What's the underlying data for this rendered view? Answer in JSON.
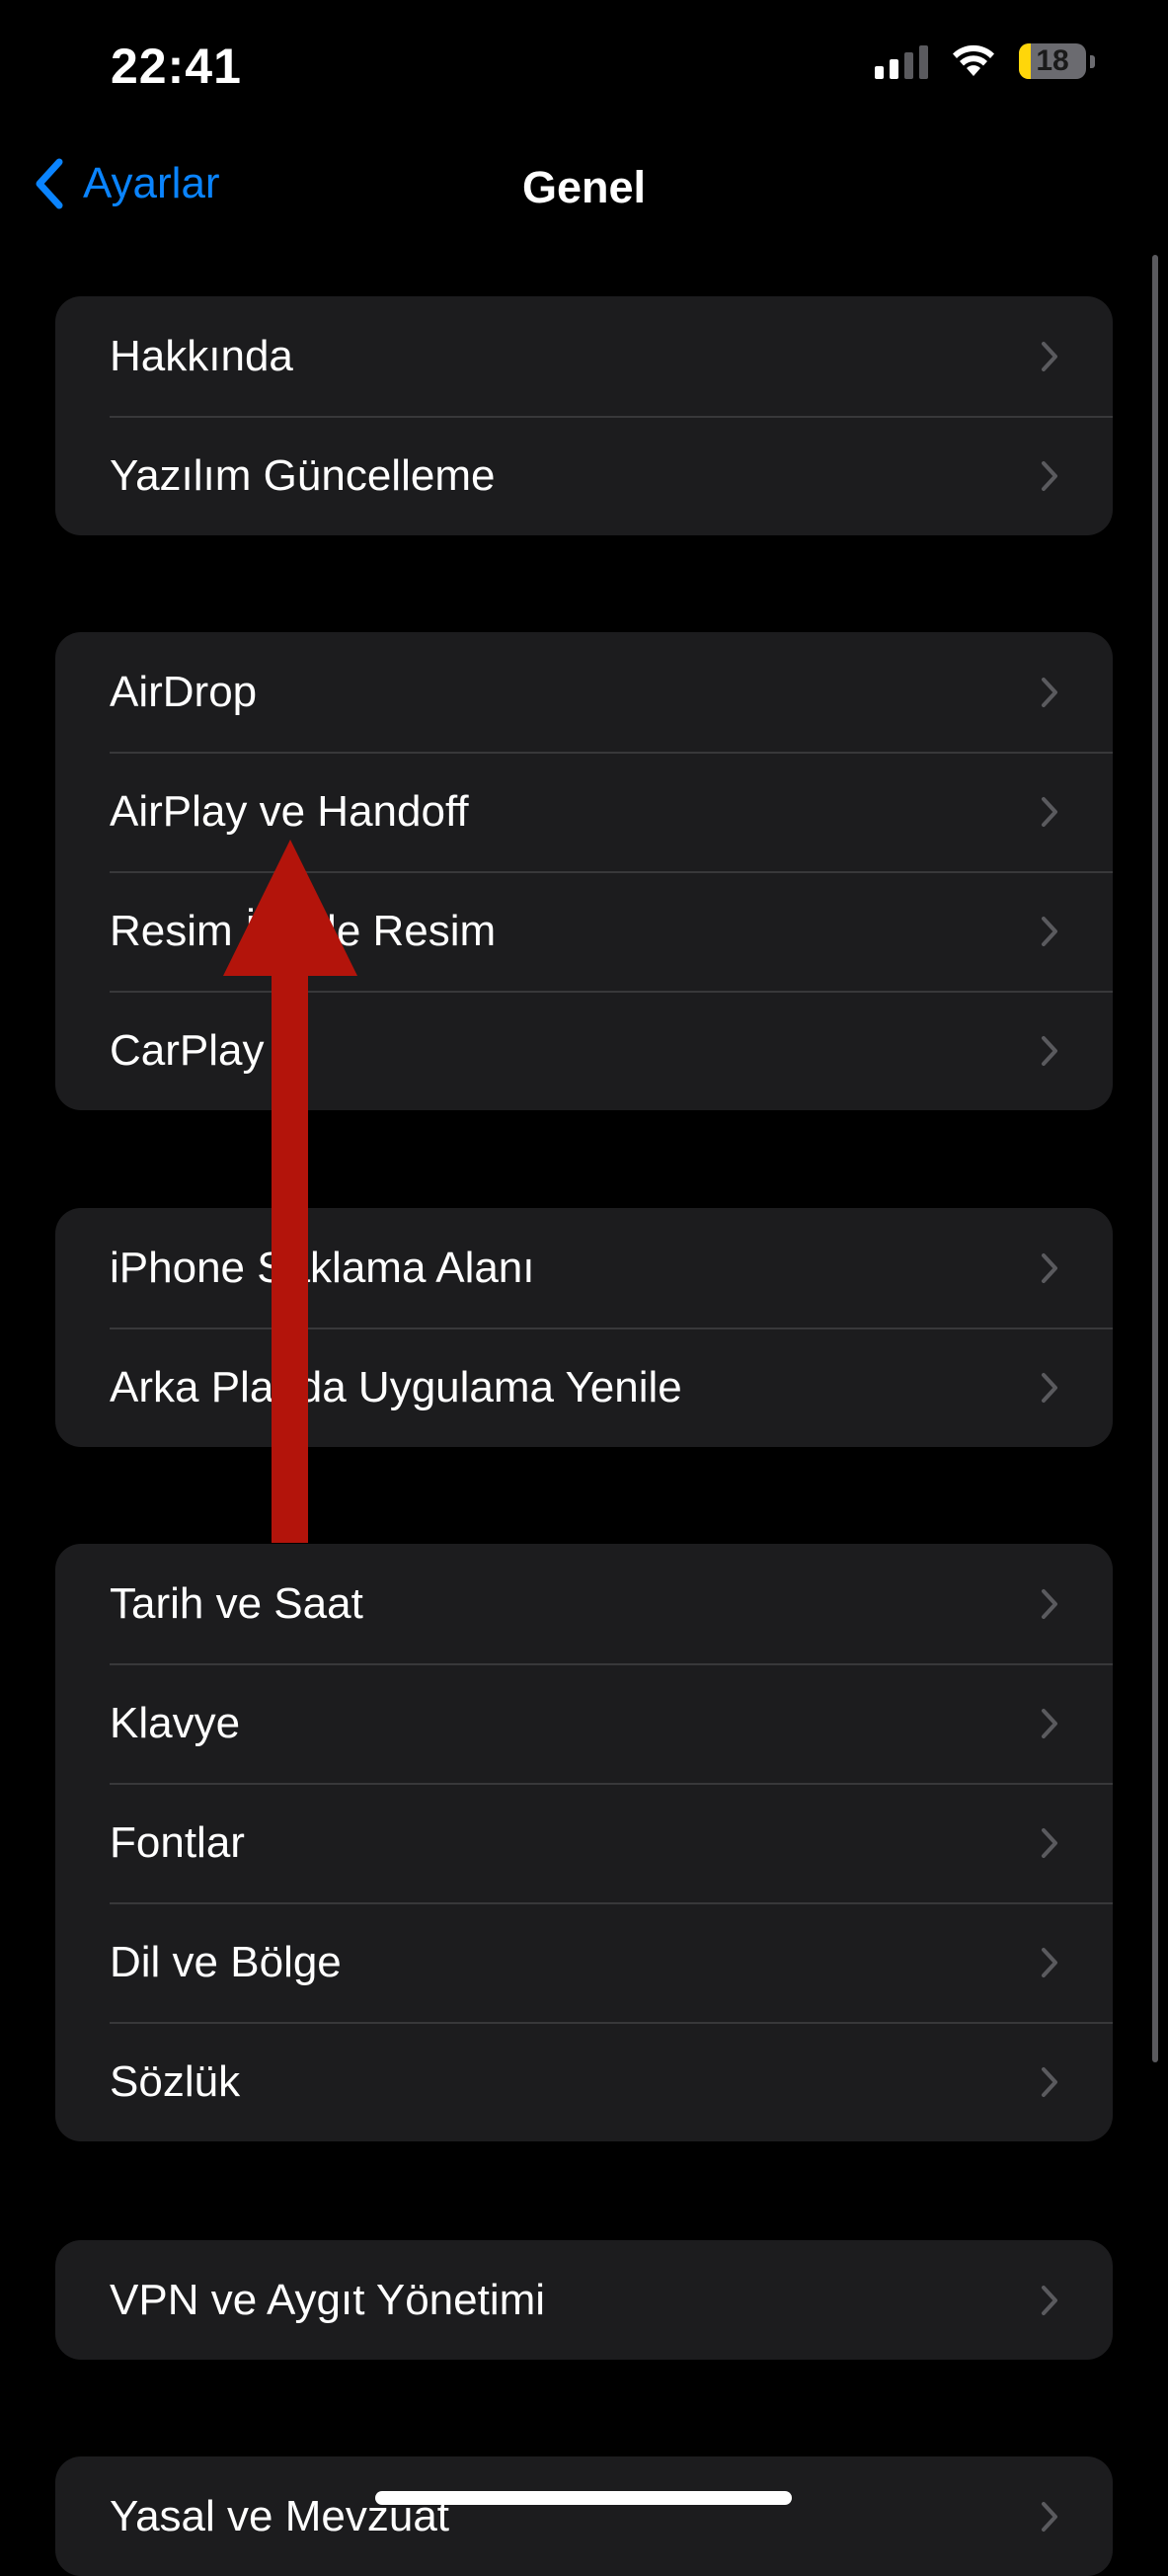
{
  "status_bar": {
    "time": "22:41",
    "battery_level": "18",
    "battery_fraction": 0.18,
    "signal_bars_active": 2,
    "icons": [
      "cellular-signal-icon",
      "wifi-icon",
      "battery-icon"
    ]
  },
  "nav": {
    "back_label": "Ayarlar",
    "title": "Genel",
    "back_icon": "chevron-left-icon"
  },
  "groups": [
    {
      "items": [
        {
          "label": "Hakkında"
        },
        {
          "label": "Yazılım Güncelleme"
        }
      ]
    },
    {
      "items": [
        {
          "label": "AirDrop"
        },
        {
          "label": "AirPlay ve Handoff"
        },
        {
          "label": "Resim İçinde Resim"
        },
        {
          "label": "CarPlay"
        }
      ]
    },
    {
      "items": [
        {
          "label": "iPhone Saklama Alanı"
        },
        {
          "label": "Arka Planda Uygulama Yenile"
        }
      ]
    },
    {
      "items": [
        {
          "label": "Tarih ve Saat"
        },
        {
          "label": "Klavye"
        },
        {
          "label": "Fontlar"
        },
        {
          "label": "Dil ve Bölge"
        },
        {
          "label": "Sözlük"
        }
      ]
    },
    {
      "items": [
        {
          "label": "VPN ve Aygıt Yönetimi"
        }
      ]
    },
    {
      "items": [
        {
          "label": "Yasal ve Mevzuat"
        }
      ]
    }
  ],
  "colors": {
    "background": "#000000",
    "cell_background": "#1c1c1e",
    "separator": "#38383a",
    "accent": "#0a84ff",
    "chevron": "#5a5a5e",
    "annotation_arrow": "#b3140b",
    "battery_fill": "#ffd60a"
  }
}
